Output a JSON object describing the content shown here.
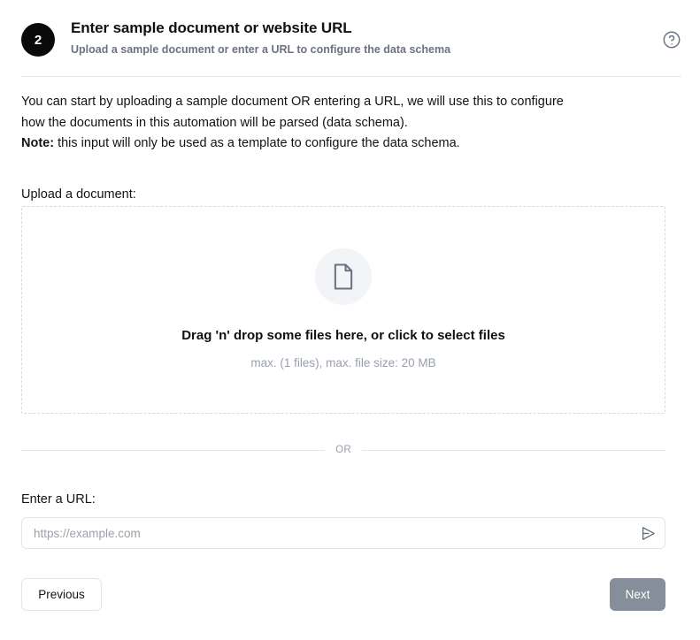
{
  "header": {
    "step_number": "2",
    "title": "Enter sample document or website URL",
    "subtitle": "Upload a sample document or enter a URL to configure the data schema",
    "help_icon": "question-mark-circle-icon"
  },
  "intro": {
    "line1": "You can start by uploading a sample document OR entering a URL, we will use this to configure",
    "line2": "how the documents in this automation will be parsed (data schema).",
    "note_label": "Note:",
    "note_text": " this input will only be used as a template to configure the data schema."
  },
  "upload": {
    "label": "Upload a document:",
    "icon": "document-file-icon",
    "primary_text": "Drag 'n' drop some files here, or click to select files",
    "constraints_text": "max. (1 files), max. file size: 20 MB"
  },
  "divider": {
    "text": "OR"
  },
  "url_section": {
    "label": "Enter a URL:",
    "placeholder": "https://example.com",
    "value": "",
    "submit_icon": "send-icon"
  },
  "footer": {
    "previous_label": "Previous",
    "next_label": "Next"
  },
  "colors": {
    "badge_background": "#0a0a0a",
    "badge_text": "#ffffff",
    "subtitle": "#6b7280",
    "muted_text": "#9aa1ab",
    "border": "#e2e5ea",
    "dropzone_border": "#d6d9de",
    "dropzone_icon_bg": "#f2f4f7",
    "next_button_bg": "#868e9b",
    "text": "#111318"
  }
}
